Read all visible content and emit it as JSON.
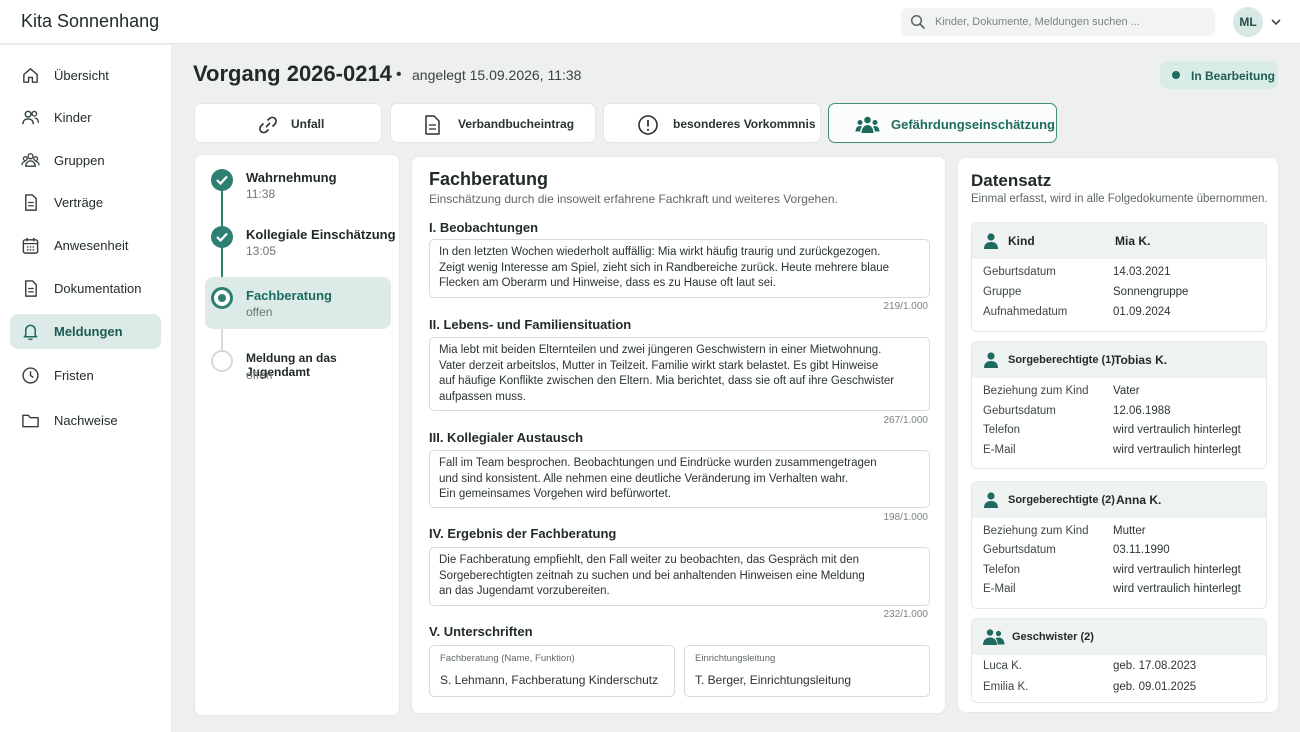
{
  "app": {
    "brand": "Kita Sonnenhang"
  },
  "search": {
    "placeholder": "Kinder, Dokumente, Meldungen suchen ..."
  },
  "user": {
    "initials": "ML"
  },
  "sidebar": {
    "items": [
      {
        "label": "Übersicht",
        "icon": "home-icon"
      },
      {
        "label": "Kinder",
        "icon": "users-icon"
      },
      {
        "label": "Gruppen",
        "icon": "group-icon"
      },
      {
        "label": "Verträge",
        "icon": "document-icon"
      },
      {
        "label": "Anwesenheit",
        "icon": "calendar-icon"
      },
      {
        "label": "Dokumentation",
        "icon": "document-icon"
      },
      {
        "label": "Meldungen",
        "icon": "bell-icon",
        "active": true
      },
      {
        "label": "Fristen",
        "icon": "clock-icon"
      },
      {
        "label": "Nachweise",
        "icon": "folder-icon"
      }
    ]
  },
  "case": {
    "title": "Vorgang 2026-0214",
    "separator": "•",
    "created": "angelegt 15.09.2026, 11:38",
    "status": "In Bearbeitung"
  },
  "tabs": [
    {
      "label": "Unfall",
      "icon": "link-icon"
    },
    {
      "label": "Verbandbucheintrag",
      "icon": "document-icon"
    },
    {
      "label": "besonderes Vorkommnis",
      "icon": "alert-icon"
    },
    {
      "label": "Gefährdungseinschätzung",
      "icon": "group-icon",
      "active": true
    }
  ],
  "steps": [
    {
      "title": "Wahrnehmung",
      "sub": "11:38",
      "state": "done"
    },
    {
      "title": "Kollegiale Einschätzung",
      "sub": "13:05",
      "state": "done"
    },
    {
      "title": "Fachberatung",
      "sub": "offen",
      "state": "current"
    },
    {
      "title": "Meldung an das Jugendamt",
      "sub": "offen",
      "state": "open"
    }
  ],
  "form": {
    "title": "Fachberatung",
    "subtitle": "Einschätzung durch die insoweit erfahrene Fachkraft und weiteres Vorgehen.",
    "sections": [
      {
        "heading": "I. Beobachtungen",
        "lines": [
          "In den letzten Wochen wiederholt auffällig: Mia wirkt häufig traurig und zurückgezogen.",
          "Zeigt wenig Interesse am Spiel, zieht sich in Randbereiche zurück. Heute mehrere blaue",
          "Flecken am Oberarm und Hinweise, dass es zu Hause oft laut sei."
        ],
        "count": "219/1.000"
      },
      {
        "heading": "II. Lebens- und Familiensituation",
        "lines": [
          "Mia lebt mit beiden Elternteilen und zwei jüngeren Geschwistern in einer Mietwohnung.",
          "Vater derzeit arbeitslos, Mutter in Teilzeit. Familie wirkt stark belastet. Es gibt Hinweise",
          "auf häufige Konflikte zwischen den Eltern. Mia berichtet, dass sie oft auf ihre Geschwister",
          "aufpassen muss."
        ],
        "count": "267/1.000"
      },
      {
        "heading": "III. Kollegialer Austausch",
        "lines": [
          "Fall im Team besprochen. Beobachtungen und Eindrücke wurden zusammengetragen",
          "und sind konsistent. Alle nehmen eine deutliche Veränderung im Verhalten wahr.",
          "Ein gemeinsames Vorgehen wird befürwortet."
        ],
        "count": "198/1.000"
      },
      {
        "heading": "IV. Ergebnis der Fachberatung",
        "lines": [
          "Die Fachberatung empfiehlt, den Fall weiter zu beobachten, das Gespräch mit den",
          "Sorgeberechtigten zeitnah zu suchen und bei anhaltenden Hinweisen eine Meldung",
          "an das Jugendamt vorzubereiten."
        ],
        "count": "232/1.000"
      }
    ],
    "signatures": {
      "heading": "V. Unterschriften",
      "left": {
        "label": "Fachberatung (Name, Funktion)",
        "value": "S. Lehmann, Fachberatung Kinderschutz"
      },
      "right": {
        "label": "Einrichtungsleitung",
        "value": "T. Berger, Einrichtungsleitung"
      }
    }
  },
  "datensatz": {
    "title": "Datensatz",
    "subtitle": "Einmal erfasst, wird in alle Folgedokumente übernommen.",
    "kind": {
      "role": "Kind",
      "name": "Mia K.",
      "rows": [
        {
          "k": "Geburtsdatum",
          "v": "14.03.2021"
        },
        {
          "k": "Gruppe",
          "v": "Sonnengruppe"
        },
        {
          "k": "Aufnahmedatum",
          "v": "01.09.2024"
        }
      ]
    },
    "sorge1": {
      "role": "Sorgeberechtigte (1)",
      "name": "Tobias K.",
      "rows": [
        {
          "k": "Beziehung zum Kind",
          "v": "Vater"
        },
        {
          "k": "Geburtsdatum",
          "v": "12.06.1988"
        },
        {
          "k": "Telefon",
          "v": "wird vertraulich hinterlegt"
        },
        {
          "k": "E-Mail",
          "v": "wird vertraulich hinterlegt"
        }
      ]
    },
    "sorge2": {
      "role": "Sorgeberechtigte (2)",
      "name": "Anna K.",
      "rows": [
        {
          "k": "Beziehung zum Kind",
          "v": "Mutter"
        },
        {
          "k": "Geburtsdatum",
          "v": "03.11.1990"
        },
        {
          "k": "Telefon",
          "v": "wird vertraulich hinterlegt"
        },
        {
          "k": "E-Mail",
          "v": "wird vertraulich hinterlegt"
        }
      ]
    },
    "geschwister": {
      "role": "Geschwister (2)",
      "rows": [
        {
          "k": "Luca K.",
          "v": "geb. 17.08.2023"
        },
        {
          "k": "Emilia K.",
          "v": "geb. 09.01.2025"
        }
      ]
    }
  },
  "colors": {
    "accent": "#2f7e72",
    "active_bg": "#dcebe8",
    "page_bg": "#edf0ef"
  }
}
